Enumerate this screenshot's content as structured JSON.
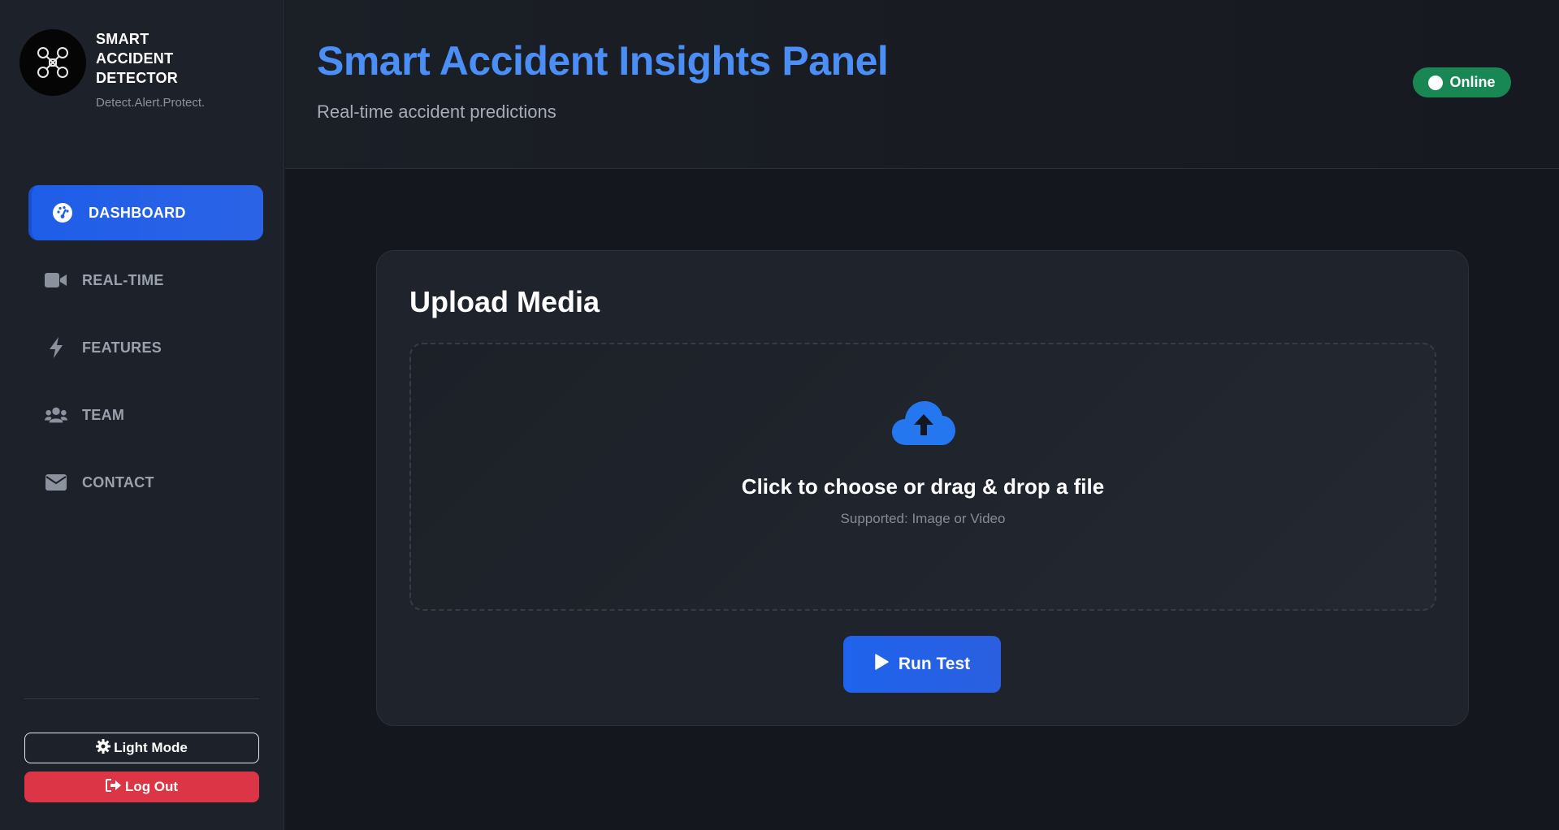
{
  "brand": {
    "title": "SMART ACCIDENT DETECTOR",
    "tagline": "Detect.Alert.Protect.",
    "logo_icon": "drone-icon"
  },
  "nav": {
    "items": [
      {
        "label": "DASHBOARD",
        "icon": "dashboard-gauge-icon",
        "active": true
      },
      {
        "label": "REAL-TIME",
        "icon": "video-camera-icon",
        "active": false
      },
      {
        "label": "FEATURES",
        "icon": "bolt-icon",
        "active": false
      },
      {
        "label": "TEAM",
        "icon": "users-icon",
        "active": false
      },
      {
        "label": "CONTACT",
        "icon": "envelope-icon",
        "active": false
      }
    ]
  },
  "footer": {
    "theme_label": "Light Mode",
    "logout_label": "Log Out"
  },
  "header": {
    "title": "Smart Accident Insights Panel",
    "subtitle": "Real-time accident predictions",
    "status": "Online"
  },
  "upload": {
    "title": "Upload Media",
    "drop_title": "Click to choose or drag & drop a file",
    "drop_hint": "Supported: Image or Video",
    "run_label": "Run Test"
  },
  "colors": {
    "accent": "#1f5ee8",
    "title_blue": "#4b8ef5",
    "online_green": "#198754",
    "logout_red": "#dc3545",
    "background": "#14171d",
    "sidebar": "#1d2129"
  }
}
